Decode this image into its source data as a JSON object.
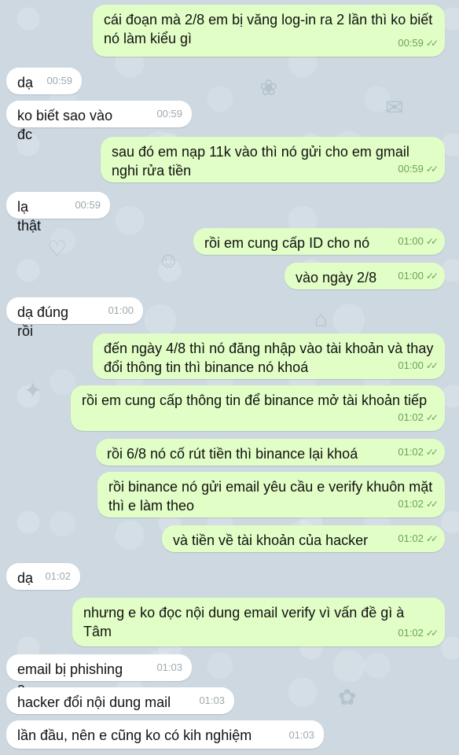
{
  "messages": [
    {
      "dir": "out",
      "text": "cái đoạn mà 2/8 em bị văng log-in ra 2 lần thì ko biết nó làm kiểu gì",
      "time": "00:59"
    },
    {
      "dir": "in",
      "text": "dạ",
      "time": "00:59"
    },
    {
      "dir": "in",
      "text": "ko biết sao vào đc",
      "time": "00:59"
    },
    {
      "dir": "out",
      "text": "sau đó em nạp 11k vào thì nó gửi cho em gmail nghi rửa tiền",
      "time": "00:59"
    },
    {
      "dir": "in",
      "text": "lạ thật",
      "time": "00:59"
    },
    {
      "dir": "out",
      "text": "rồi em cung cấp ID cho nó",
      "time": "01:00"
    },
    {
      "dir": "out",
      "text": "vào ngày 2/8",
      "time": "01:00"
    },
    {
      "dir": "in",
      "text": "dạ đúng rồi",
      "time": "01:00"
    },
    {
      "dir": "out",
      "text": "đến ngày 4/8 thì nó đăng nhập vào tài khoản và thay đổi thông tin thì binance nó khoá",
      "time": "01:00"
    },
    {
      "dir": "out",
      "text": "rồi em cung cấp thông tin để binance mở tài khoản tiếp",
      "time": "01:02"
    },
    {
      "dir": "out",
      "text": "rồi 6/8 nó cố rút tiền thì binance lại khoá",
      "time": "01:02"
    },
    {
      "dir": "out",
      "text": "rồi binance nó gửi email yêu cầu e verify khuôn mặt thì e làm theo",
      "time": "01:02"
    },
    {
      "dir": "out",
      "text": "và tiền về tài khoản của hacker",
      "time": "01:02"
    },
    {
      "dir": "in",
      "text": "dạ",
      "time": "01:02"
    },
    {
      "dir": "out",
      "text": "nhưng e ko đọc nội dung email verify vì vấn đề gì à Tâm",
      "time": "01:02"
    },
    {
      "dir": "in",
      "text": "email bị phishing a",
      "time": "01:03"
    },
    {
      "dir": "in",
      "text": "hacker đổi nội dung mail",
      "time": "01:03"
    },
    {
      "dir": "in",
      "text": "lần đầu, nên e cũng ko có kih nghiệm",
      "time": "01:03"
    }
  ],
  "colors": {
    "outgoing": "#e1fec6",
    "incoming": "#ffffff",
    "background": "#cdd8e1",
    "read_check": "#6aa35c"
  },
  "icons": {
    "read_receipt": "double-check-icon"
  }
}
